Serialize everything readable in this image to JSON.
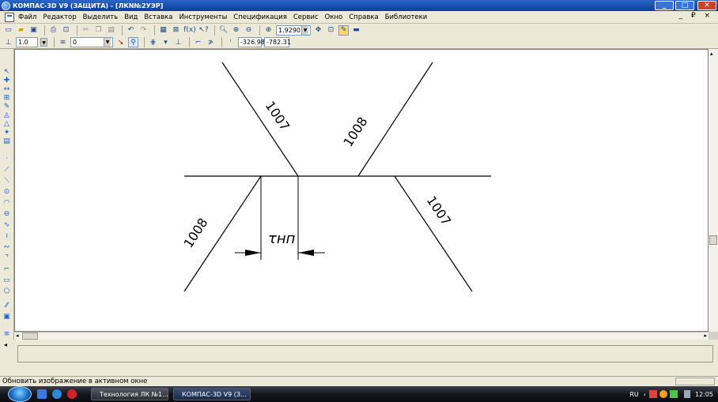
{
  "window": {
    "title": "КОМПАС-3D V9 (ЗАЩИТА) - [ЛКN№2УЭР]",
    "min_label": "_",
    "max_label": "□",
    "close_label": "✕"
  },
  "menu": {
    "items": [
      "Файл",
      "Редактор",
      "Выделить",
      "Вид",
      "Вставка",
      "Инструменты",
      "Спецификация",
      "Сервис",
      "Окно",
      "Справка",
      "Библиотеки"
    ],
    "mdi_controls": "_ ₽ ×"
  },
  "toolbar": {
    "zoom_value": "1.9290",
    "style_value": "1.0",
    "layer_value": "0",
    "coord_x": "-326.98",
    "coord_y": "-782.31",
    "fx_label": "f(x)"
  },
  "drawing": {
    "labels": [
      "1007",
      "1008",
      "1008",
      "1007"
    ],
    "dimension_label": "τнп"
  },
  "statusbar": {
    "message": "Обновить изображение в активном окне"
  },
  "taskbar": {
    "tasks": [
      {
        "label": "Технология ЛК №1...",
        "icon": "word-icon"
      },
      {
        "label": "КОМПАС-3D V9 (З...",
        "icon": "kompas-icon"
      }
    ],
    "lang": "RU",
    "clock": "12:05"
  }
}
